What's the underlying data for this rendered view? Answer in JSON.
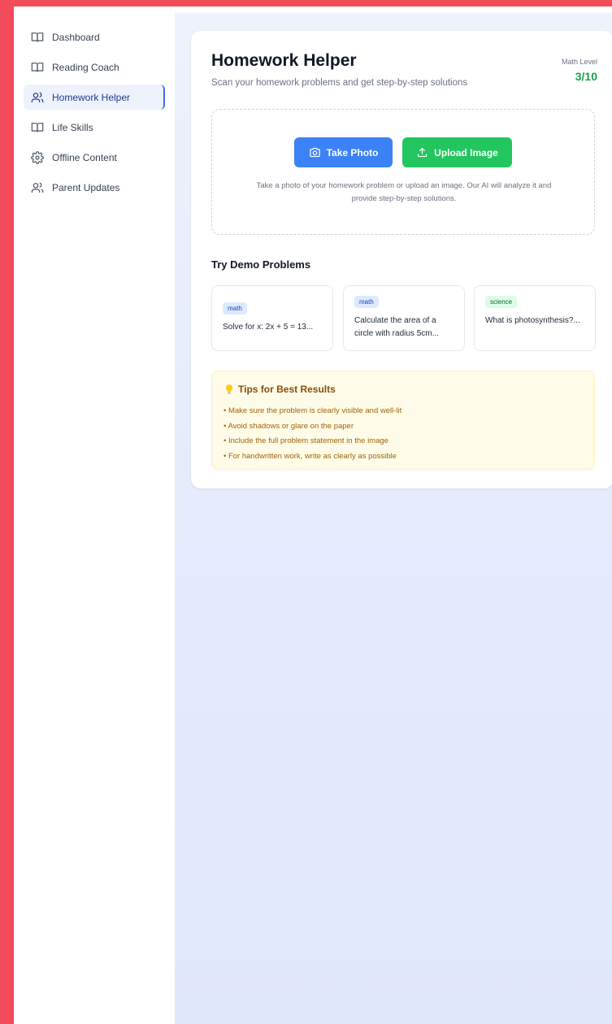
{
  "sidebar": {
    "items": [
      {
        "label": "Dashboard",
        "icon": "book-open-icon"
      },
      {
        "label": "Reading Coach",
        "icon": "book-open-icon"
      },
      {
        "label": "Homework Helper",
        "icon": "users-icon",
        "active": true
      },
      {
        "label": "Life Skills",
        "icon": "book-open-icon"
      },
      {
        "label": "Offline Content",
        "icon": "gear-icon"
      },
      {
        "label": "Parent Updates",
        "icon": "users-icon"
      }
    ]
  },
  "header": {
    "title": "Homework Helper",
    "subtitle": "Scan your homework problems and get step-by-step solutions",
    "level_label": "Math Level",
    "level_value": "3/10"
  },
  "upload": {
    "take_photo_label": "Take Photo",
    "upload_image_label": "Upload Image",
    "hint": "Take a photo of your homework problem or upload an image. Our AI will analyze it and provide step-by-step solutions."
  },
  "demo": {
    "heading": "Try Demo Problems",
    "problems": [
      {
        "tag": "math",
        "text": "Solve for x: 2x + 5 = 13..."
      },
      {
        "tag": "math",
        "text": "Calculate the area of a circle with radius 5cm..."
      },
      {
        "tag": "science",
        "text": "What is photosynthesis?..."
      }
    ]
  },
  "tips": {
    "title": "Tips for Best Results",
    "items": [
      "• Make sure the problem is clearly visible and well-lit",
      "• Avoid shadows or glare on the paper",
      "• Include the full problem statement in the image",
      "• For handwritten work, write as clearly as possible"
    ]
  },
  "colors": {
    "accent_blue": "#3b82f6",
    "accent_green": "#22c55e",
    "frame_red": "#f24c5a",
    "level_green": "#16a34a"
  }
}
